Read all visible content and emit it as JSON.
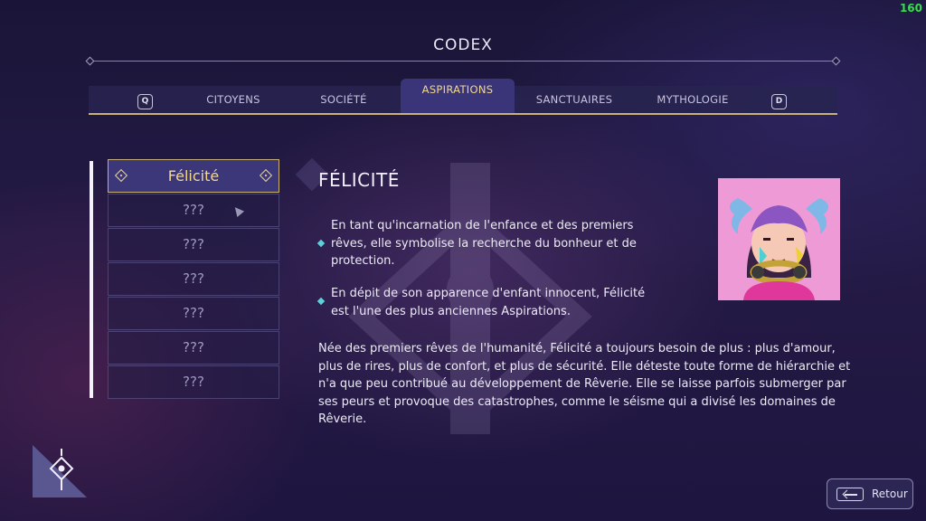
{
  "fps": "160",
  "header": {
    "title": "CODEX"
  },
  "tabs": {
    "prev_key": "Q",
    "next_key": "D",
    "items": [
      "CITOYENS",
      "SOCIÉTÉ",
      "ASPIRATIONS",
      "SANCTUAIRES",
      "MYTHOLOGIE"
    ],
    "active": "ASPIRATIONS"
  },
  "list": {
    "items": [
      "Félicité",
      "???",
      "???",
      "???",
      "???",
      "???",
      "???"
    ],
    "selected": "Félicité"
  },
  "entry": {
    "name": "FÉLICITÉ",
    "bullets": [
      "En tant qu'incarnation de l'enfance et des premiers rêves, elle symbolise la recherche du bonheur et de protection.",
      "En dépit de son apparence d'enfant innocent, Félicité est l'une des plus anciennes Aspirations."
    ],
    "description": "Née des premiers rêves de l'humanité, Félicité a toujours besoin de plus : plus d'amour, plus de rires, plus de confort, et plus de sécurité. Elle déteste toute forme de hiérarchie et n'a que peu contribué au développement de Rêverie. Elle se laisse parfois submerger par ses peurs et provoque des catastrophes, comme le séisme qui a divisé les domaines de Rêverie."
  },
  "footer": {
    "back_label": "Retour"
  },
  "colors": {
    "accent_gold": "#c9b27a",
    "bullet_cyan": "#5ed0d8",
    "fps_green": "#35e04a"
  },
  "icons": [
    "eye-emblem-icon",
    "back-arrow-key-icon",
    "diamond-icon"
  ]
}
